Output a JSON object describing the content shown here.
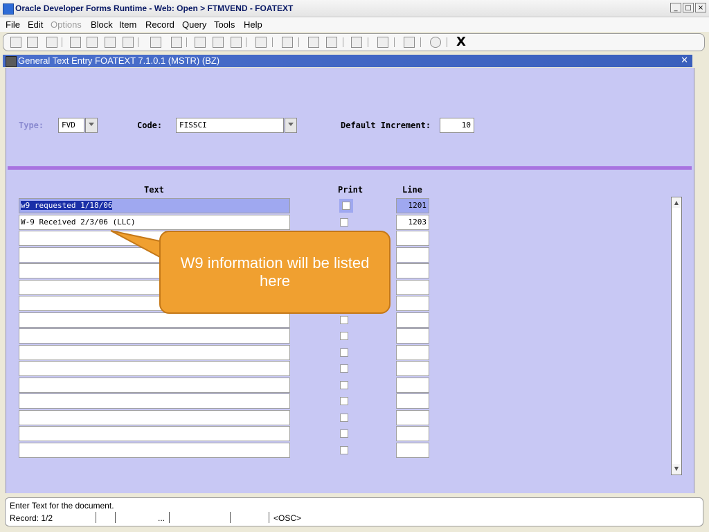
{
  "window": {
    "title": "Oracle Developer Forms Runtime - Web: Open > FTMVEND - FOATEXT"
  },
  "menu": {
    "items": [
      {
        "label": "File",
        "disabled": false
      },
      {
        "label": "Edit",
        "disabled": false
      },
      {
        "label": "Options",
        "disabled": true
      },
      {
        "label": "Block",
        "disabled": false
      },
      {
        "label": "Item",
        "disabled": false
      },
      {
        "label": "Record",
        "disabled": false
      },
      {
        "label": "Query",
        "disabled": false
      },
      {
        "label": "Tools",
        "disabled": false
      },
      {
        "label": "Help",
        "disabled": false
      }
    ]
  },
  "toolbar": {
    "exit_label": "X"
  },
  "form": {
    "title": "General Text Entry  FOATEXT  7.1.0.1  (MSTR)  (BZ)",
    "close_glyph": "✕"
  },
  "key_block": {
    "type_label": "Type:",
    "type_value": "FVD",
    "code_label": "Code:",
    "code_value": "FISSCI",
    "increment_label": "Default Increment:",
    "increment_value": "10"
  },
  "grid": {
    "headers": {
      "text": "Text",
      "print": "Print",
      "line": "Line"
    },
    "rows": [
      {
        "text": "w9 requested 1/18/06",
        "line": "1201"
      },
      {
        "text": "W-9 Received 2/3/06 (LLC)",
        "line": "1203"
      },
      {
        "text": "",
        "line": ""
      },
      {
        "text": "",
        "line": ""
      },
      {
        "text": "",
        "line": ""
      },
      {
        "text": "",
        "line": ""
      },
      {
        "text": "",
        "line": ""
      },
      {
        "text": "",
        "line": ""
      },
      {
        "text": "",
        "line": ""
      },
      {
        "text": "",
        "line": ""
      },
      {
        "text": "",
        "line": ""
      },
      {
        "text": "",
        "line": ""
      },
      {
        "text": "",
        "line": ""
      },
      {
        "text": "",
        "line": ""
      },
      {
        "text": "",
        "line": ""
      },
      {
        "text": "",
        "line": ""
      }
    ]
  },
  "callout": {
    "text": "W9 information will be listed here"
  },
  "status": {
    "message": "Enter Text for the document.",
    "record": "Record: 1/2",
    "ellipsis": "...",
    "mode": "<OSC>"
  },
  "colors": {
    "form_bg": "#c8c8f4",
    "title_blue": "#3a5fbc",
    "divider": "#a873e0",
    "callout": "#f0a030"
  }
}
